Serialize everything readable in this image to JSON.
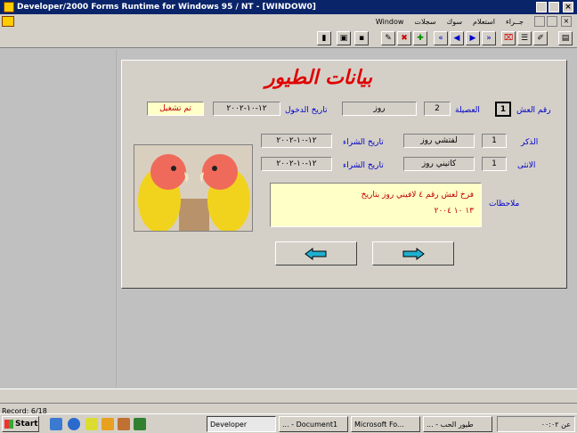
{
  "window": {
    "title": "Developer/2000 Forms Runtime for Windows 95 / NT - [WINDOW0]"
  },
  "menu": {
    "items": [
      "Window",
      "سجلات",
      "سوك",
      "استعلام",
      "جــراء"
    ]
  },
  "form": {
    "heading": "بيانات الطيور",
    "labels": {
      "nest_number": "رقم العش",
      "family": "العصيلة",
      "entry_date": "تاريخ الدخول",
      "male": "الذكر",
      "female": "الانثى",
      "purchase_date_1": "تاريخ الشراء",
      "purchase_date_2": "تاريخ الشراء",
      "notes": "ملاحظات"
    },
    "values": {
      "nest_number": "1",
      "family": "2",
      "family_name": "روز",
      "entry_date": "١٢-١٠-٢٠٠٢",
      "status": "تم تشغيل",
      "male_code": "1",
      "male_name": "لفتشي روز",
      "male_date": "١٢-١٠-٢٠٠٢",
      "female_code": "1",
      "female_name": "كاتيني روز",
      "female_date": "١٢-١٠-٢٠٠٢",
      "notes_line1": "فرخ لعش رقم ٤ لافيني روز بتاريخ",
      "notes_line2": "١٣  ١٠  ٢٠٠٤"
    }
  },
  "status": {
    "record": "Record: 6/18"
  },
  "taskbar": {
    "start": "Start",
    "tasks": [
      "Developer",
      "... - Document1",
      "Microsoft Fo...",
      "... - طيور الحب"
    ],
    "clock": "عن ٠٠:٠٢"
  }
}
